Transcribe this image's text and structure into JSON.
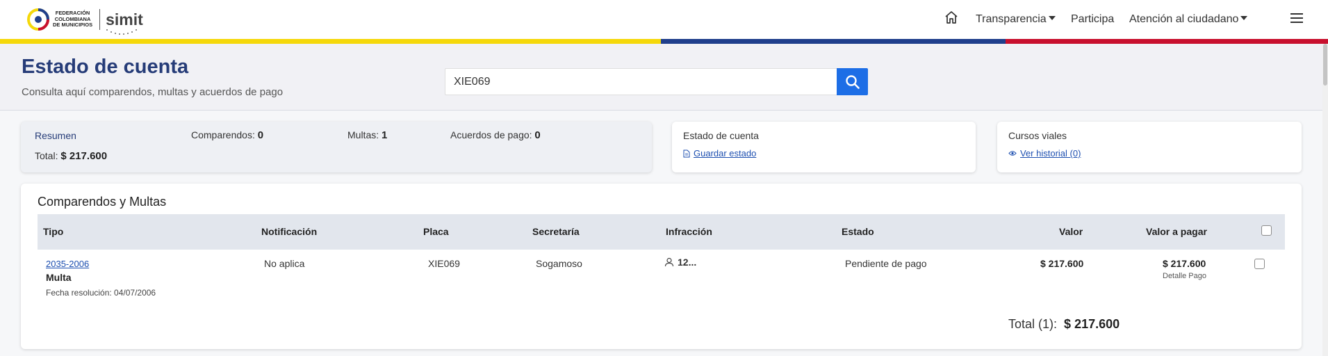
{
  "header": {
    "logo_lines": [
      "FEDERACIÓN",
      "COLOMBIANA",
      "DE MUNICIPIOS"
    ],
    "brand": "simit",
    "nav": [
      {
        "label": "Transparencia",
        "has_caret": true
      },
      {
        "label": "Participa",
        "has_caret": false
      },
      {
        "label": "Atención al ciudadano",
        "has_caret": true
      }
    ],
    "icons": [
      "home-icon",
      "hamburger-menu-icon"
    ]
  },
  "flag_colors": [
    "#f5d80a",
    "#203f8c",
    "#c8102e"
  ],
  "hero": {
    "title": "Estado de cuenta",
    "subtitle": "Consulta aquí comparendos, multas y acuerdos de pago",
    "search_value": "XIE069",
    "search_icon": "search-icon"
  },
  "resumen": {
    "title": "Resumen",
    "comparendos_label": "Comparendos:",
    "comparendos_value": "0",
    "multas_label": "Multas:",
    "multas_value": "1",
    "acuerdos_label": "Acuerdos de pago:",
    "acuerdos_value": "0",
    "total_label": "Total:",
    "total_value": "$ 217.600"
  },
  "estado_card": {
    "title": "Estado de cuenta",
    "link": "Guardar estado",
    "icon": "document-icon"
  },
  "cursos_card": {
    "title": "Cursos viales",
    "link": "Ver historial (0)",
    "icon": "eye-icon"
  },
  "table": {
    "title": "Comparendos y Multas",
    "headers": {
      "tipo": "Tipo",
      "notificacion": "Notificación",
      "placa": "Placa",
      "secretaria": "Secretaría",
      "infraccion": "Infracción",
      "estado": "Estado",
      "valor": "Valor",
      "valor_pagar": "Valor a pagar"
    },
    "rows": [
      {
        "numero": "2035-2006",
        "tipo": "Multa",
        "fecha": "Fecha resolución: 04/07/2006",
        "notificacion": "No aplica",
        "placa": "XIE069",
        "secretaria": "Sogamoso",
        "infraccion": "12...",
        "estado": "Pendiente de pago",
        "valor": "$ 217.600",
        "valor_pagar": "$ 217.600",
        "detalle": "Detalle Pago"
      }
    ],
    "total_label": "Total (1):",
    "total_value": "$ 217.600"
  }
}
